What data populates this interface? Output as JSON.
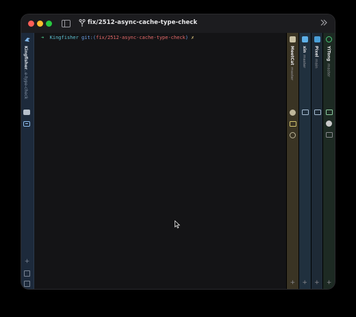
{
  "window": {
    "title": "fix/2512-async-cache-type-check"
  },
  "sidebar": {
    "project_name": "Kingfisher",
    "project_branch": "...e-type-check"
  },
  "terminal": {
    "prompt_arrow": "➜",
    "prompt_dir": "Kingfisher",
    "prompt_git": "git:(",
    "prompt_branch": "fix/2512-async-cache-type-check",
    "prompt_close": ")",
    "prompt_mark": "✗"
  },
  "panes": [
    {
      "name": "MeetCat",
      "branch": "master",
      "color": "#3a3424"
    },
    {
      "name": "xin",
      "branch": "master",
      "color": "#20303e"
    },
    {
      "name": "Pixel",
      "branch": "main",
      "color": "#1e2a36"
    },
    {
      "name": "YiTong",
      "branch": "master",
      "color": "#1d2a23"
    }
  ],
  "icons": {
    "add": "+"
  }
}
